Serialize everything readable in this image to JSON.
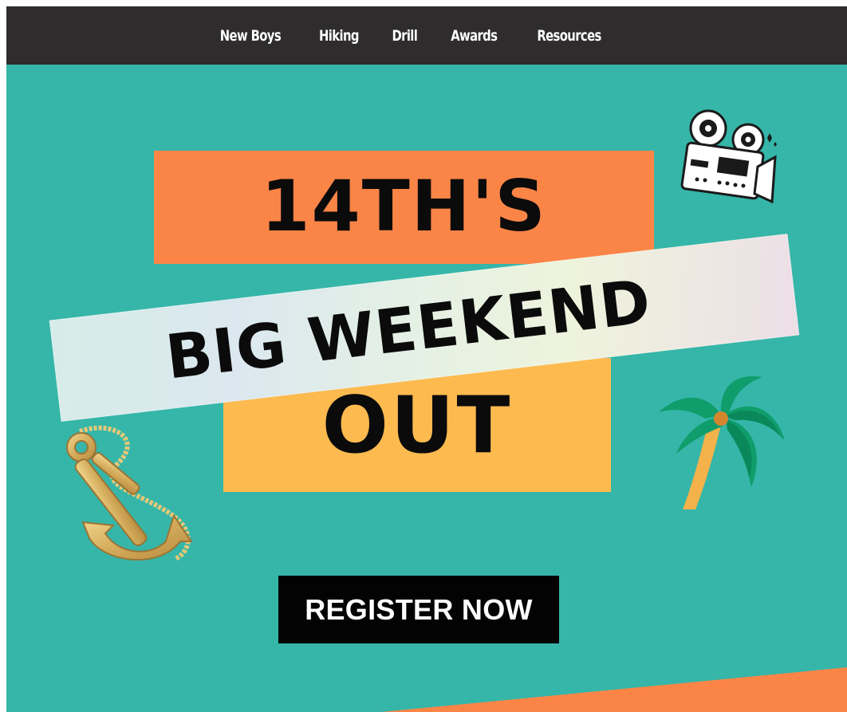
{
  "nav": {
    "items": [
      {
        "label": "New Boys"
      },
      {
        "label": "Hiking"
      },
      {
        "label": "Drill"
      },
      {
        "label": "Awards"
      },
      {
        "label": "Resources"
      }
    ]
  },
  "hero": {
    "line1": "14TH'S",
    "line2": "BIG WEEKEND",
    "line3": "OUT",
    "cta_label": "REGISTER NOW"
  },
  "colors": {
    "nav_bg": "#2e2c2d",
    "hero_bg": "#35b6a9",
    "orange": "#fb8547",
    "yellow": "#fdba4f",
    "button_bg": "#030303"
  },
  "icons": [
    "film-camera-icon",
    "anchor-icon",
    "palm-tree-icon"
  ]
}
